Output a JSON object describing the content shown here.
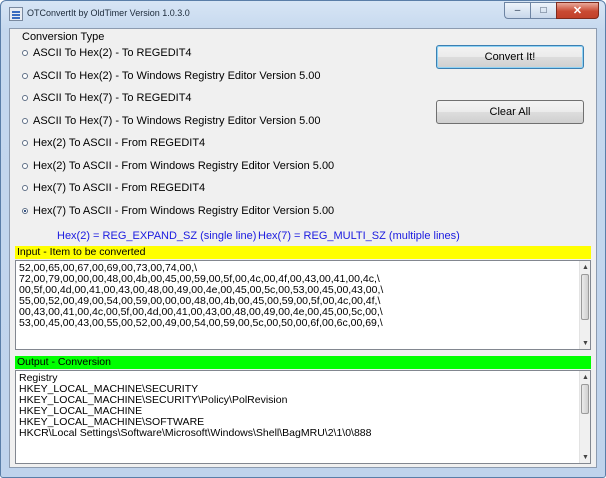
{
  "window": {
    "title": "OTConvertIt by OldTimer Version 1.0.3.0",
    "min_glyph": "–",
    "max_glyph": "□",
    "close_glyph": "✕"
  },
  "conversion": {
    "group_label": "Conversion Type",
    "options": [
      {
        "label": "ASCII To Hex(2) - To REGEDIT4",
        "selected": false
      },
      {
        "label": "ASCII To Hex(2) - To Windows Registry Editor Version 5.00",
        "selected": false
      },
      {
        "label": "ASCII To Hex(7) - To REGEDIT4",
        "selected": false
      },
      {
        "label": "ASCII To Hex(7) - To Windows Registry Editor Version 5.00",
        "selected": false
      },
      {
        "label": "Hex(2) To ASCII - From REGEDIT4",
        "selected": false
      },
      {
        "label": "Hex(2) To ASCII - From Windows Registry Editor Version 5.00",
        "selected": false
      },
      {
        "label": "Hex(7) To ASCII - From REGEDIT4",
        "selected": false
      },
      {
        "label": "Hex(7) To ASCII - From Windows Registry Editor Version 5.00",
        "selected": true
      }
    ]
  },
  "buttons": {
    "convert": "Convert It!",
    "clear": "Clear All"
  },
  "hints": {
    "hex2": "Hex(2) = REG_EXPAND_SZ (single line)",
    "hex7": "Hex(7) = REG_MULTI_SZ (multiple lines)"
  },
  "input": {
    "header": "Input - Item to be converted",
    "lines": [
      "52,00,65,00,67,00,69,00,73,00,74,00,\\",
      "  72,00,79,00,00,00,48,00,4b,00,45,00,59,00,5f,00,4c,00,4f,00,43,00,41,00,4c,\\",
      "  00,5f,00,4d,00,41,00,43,00,48,00,49,00,4e,00,45,00,5c,00,53,00,45,00,43,00,\\",
      "  55,00,52,00,49,00,54,00,59,00,00,00,48,00,4b,00,45,00,59,00,5f,00,4c,00,4f,\\",
      "  00,43,00,41,00,4c,00,5f,00,4d,00,41,00,43,00,48,00,49,00,4e,00,45,00,5c,00,\\",
      "  53,00,45,00,43,00,55,00,52,00,49,00,54,00,59,00,5c,00,50,00,6f,00,6c,00,69,\\"
    ]
  },
  "output": {
    "header": "Output - Conversion",
    "lines": [
      "Registry",
      "HKEY_LOCAL_MACHINE\\SECURITY",
      "HKEY_LOCAL_MACHINE\\SECURITY\\Policy\\PolRevision",
      "HKEY_LOCAL_MACHINE",
      "HKEY_LOCAL_MACHINE\\SOFTWARE",
      "HKCR\\Local Settings\\Software\\Microsoft\\Windows\\Shell\\BagMRU\\2\\1\\0\\888"
    ]
  },
  "scroll_glyphs": {
    "up": "▲",
    "down": "▼"
  },
  "colors": {
    "input_header": "#ffff00",
    "output_header": "#00ff00",
    "hint_text": "#1a1ae0"
  }
}
